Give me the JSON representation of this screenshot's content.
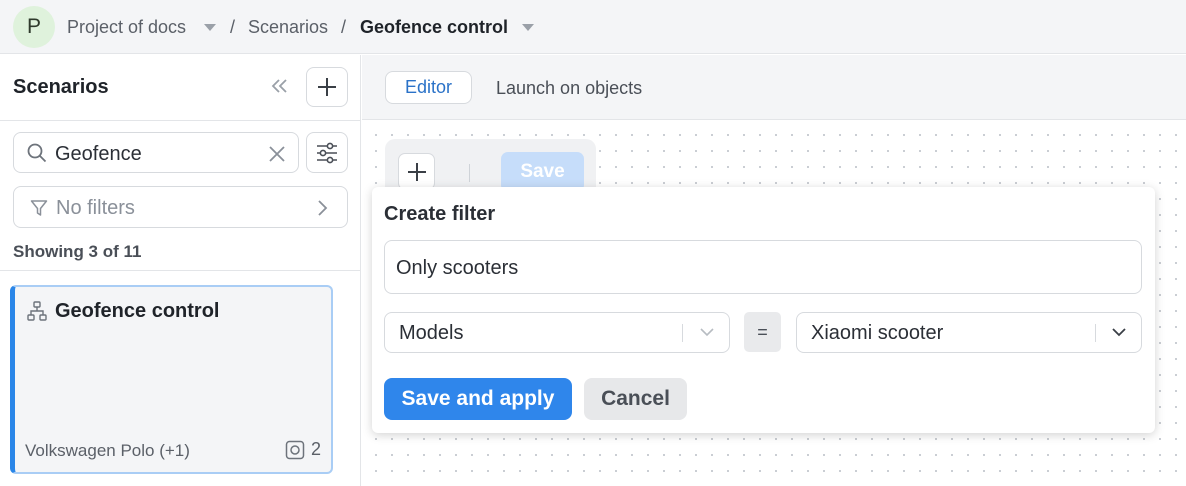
{
  "header": {
    "avatar_letter": "P",
    "project": "Project of docs",
    "separator": "/",
    "section": "Scenarios",
    "current": "Geofence control"
  },
  "sidebar": {
    "title": "Scenarios",
    "search_value": "Geofence",
    "filters_label": "No filters",
    "showing": "Showing 3 of 11",
    "card": {
      "title": "Geofence control",
      "objects": "Volkswagen Polo (+1)",
      "count": "2"
    }
  },
  "tabs": {
    "editor": "Editor",
    "launch": "Launch on objects"
  },
  "toolbar": {
    "save_label": "Save"
  },
  "popup": {
    "title": "Create filter",
    "name_value": "Only scooters",
    "field_value": "Models",
    "operator": "=",
    "value_value": "Xiaomi scooter",
    "apply_label": "Save and apply",
    "cancel_label": "Cancel"
  },
  "colors": {
    "accent": "#2f86eb",
    "avatar_bg": "#dff2dc",
    "card_border": "#2a86e8"
  }
}
